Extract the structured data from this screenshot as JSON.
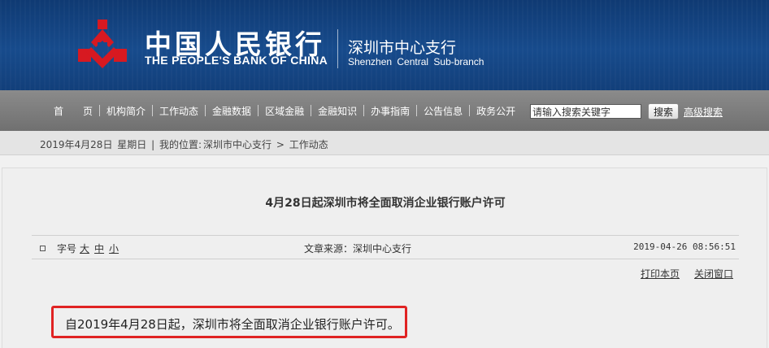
{
  "header": {
    "bank_name_cn": "中国人民银行",
    "bank_name_en": "THE PEOPLE'S BANK OF CHINA",
    "branch_cn": "深圳市中心支行",
    "branch_en": "Shenzhen Central Sub-branch",
    "logo_icon": "pboc-emblem-icon",
    "brand_color": "#174b8c",
    "logo_color": "#d71921"
  },
  "nav": {
    "items": [
      "首　　页",
      "机构简介",
      "工作动态",
      "金融数据",
      "区域金融",
      "金融知识",
      "办事指南",
      "公告信息",
      "政务公开"
    ],
    "search_placeholder": "请输入搜索关键字",
    "search_button": "搜索",
    "advanced_search": "高级搜索"
  },
  "breadcrumb": {
    "date": "2019年4月28日",
    "weekday": "星期日",
    "separator": "|",
    "location_label": "我的位置:",
    "path": [
      "深圳市中心支行",
      "工作动态"
    ],
    "arrow": ">"
  },
  "article": {
    "title": "4月28日起深圳市将全面取消企业银行账户许可",
    "font_size_label": "字号",
    "font_sizes": [
      "大",
      "中",
      "小"
    ],
    "source": "文章来源：深圳中心支行",
    "date": "2019-04-26 08:56:51",
    "print": "打印本页",
    "close": "关闭窗口",
    "body": "自2019年4月28日起，深圳市将全面取消企业银行账户许可。",
    "highlight_color": "#e02323"
  }
}
